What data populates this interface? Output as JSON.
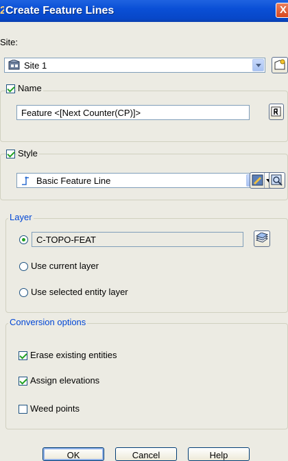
{
  "window": {
    "title": "Create Feature Lines",
    "close_glyph": "X"
  },
  "site": {
    "label": "Site:",
    "value": "Site 1",
    "icon": "site-icon",
    "new_site_icon": "new-site-icon"
  },
  "name": {
    "label": "Name",
    "checked": true,
    "value": "Feature <[Next Counter(CP)]>",
    "edit_icon": "name-template-icon"
  },
  "style": {
    "label": "Style",
    "checked": true,
    "value": "Basic Feature Line",
    "icon": "feature-line-style-icon",
    "edit_icon": "edit-style-icon",
    "preview_icon": "style-preview-icon"
  },
  "layer": {
    "group_label": "Layer",
    "layer_value": "C-TOPO-FEAT",
    "layer_selected": true,
    "layer_icon": "layer-select-icon",
    "use_current_label": "Use current layer",
    "use_current_selected": false,
    "use_selected_label": "Use selected entity layer",
    "use_selected_selected": false
  },
  "conversion": {
    "group_label": "Conversion options",
    "erase_label": "Erase existing entities",
    "erase_checked": true,
    "assign_label": "Assign elevations",
    "assign_checked": true,
    "weed_label": "Weed points",
    "weed_checked": false
  },
  "buttons": {
    "ok": "OK",
    "cancel": "Cancel",
    "help": "Help"
  },
  "colors": {
    "title_bar": "#0a4fd6",
    "group_title": "#0046d5",
    "check_mark": "#21a121",
    "dialog_bg": "#ecebe3"
  }
}
